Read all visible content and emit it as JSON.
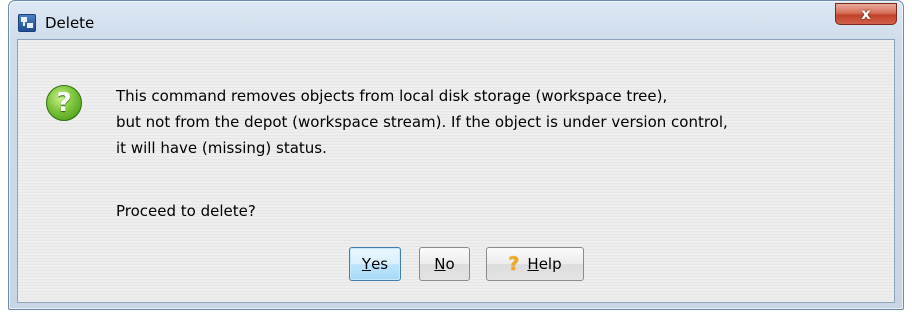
{
  "window": {
    "title": "Delete",
    "close_label": "x"
  },
  "dialog": {
    "icon_glyph": "?",
    "message_lines": [
      "This command removes objects from local disk storage (workspace tree),",
      "but not from the depot (workspace stream).  If the object is under version control,",
      "it will have (missing) status."
    ],
    "prompt": "Proceed to delete?"
  },
  "buttons": {
    "yes": {
      "mnemonic": "Y",
      "rest": "es"
    },
    "no": {
      "mnemonic": "N",
      "rest": "o"
    },
    "help": {
      "icon_glyph": "?",
      "mnemonic": "H",
      "rest": "elp"
    }
  },
  "icons": {
    "app": "application-icon",
    "dialog": "question-icon",
    "help": "help-question-icon",
    "close": "close-icon"
  },
  "colors": {
    "title_bar": "#cfdcea",
    "close_button": "#c2422a",
    "default_button_border": "#3c7fb1",
    "question_icon": "#7cc53b",
    "help_icon": "#f2a81d"
  }
}
